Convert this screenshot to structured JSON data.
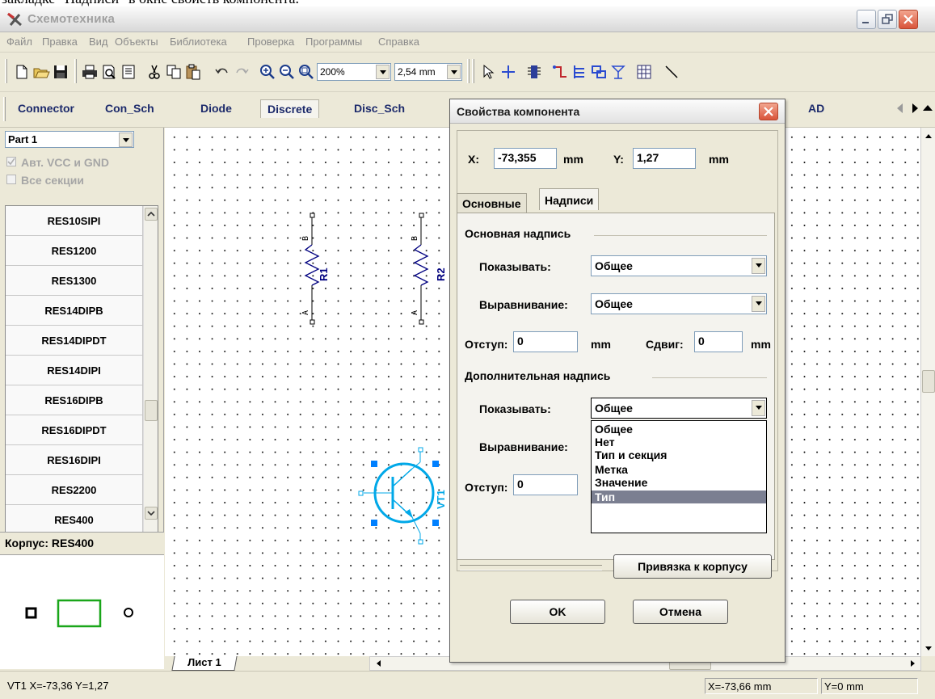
{
  "caption_fragment": "закладке \"Надписи\" в окне свойств компонента.",
  "window": {
    "title": "Схемотехника"
  },
  "menu": [
    "Файл",
    "Правка",
    "Вид",
    "Объекты",
    "Библиотека",
    "Проверка",
    "Программы",
    "Справка"
  ],
  "toolbar": {
    "zoom_value": "200%",
    "grid_value": "2,54 mm"
  },
  "library_tabs": {
    "items": [
      "Connector",
      "Con_Sch",
      "Diode",
      "Discrete",
      "Disc_Sch",
      "AD"
    ],
    "active": "Discrete"
  },
  "left_panel": {
    "part_select": "Part 1",
    "auto_vcc_gnd": "Авт. VCC и GND",
    "all_sections": "Все секции",
    "components": [
      "RES10SIPI",
      "RES1200",
      "RES1300",
      "RES14DIPB",
      "RES14DIPDT",
      "RES14DIPI",
      "RES16DIPB",
      "RES16DIPDT",
      "RES16DIPI",
      "RES2200",
      "RES400"
    ],
    "footprint_label": "Корпус: RES400"
  },
  "schematic": {
    "resistors": [
      {
        "ref": "R1",
        "pin_top": "B",
        "pin_bottom": "A"
      },
      {
        "ref": "R2",
        "pin_top": "B",
        "pin_bottom": "A"
      }
    ],
    "transistor": {
      "ref": "VT1"
    },
    "colors": {
      "component": "#000080",
      "selected": "#00a8e8",
      "handle": "#0080ff"
    }
  },
  "sheet_tab": "Лист 1",
  "status": {
    "left": "VT1  X=-73,36 Y=1,27",
    "x": "X=-73,66 mm",
    "y": "Y=0 mm"
  },
  "dialog": {
    "title": "Свойства компонента",
    "x_label": "X:",
    "x_value": "-73,355",
    "y_label": "Y:",
    "y_value": "1,27",
    "unit": "mm",
    "tabs": [
      "Основные",
      "Надписи"
    ],
    "active_tab": "Надписи",
    "main_label_group": "Основная надпись",
    "show_label": "Показывать:",
    "show_value": "Общее",
    "align_label": "Выравнивание:",
    "align_value": "Общее",
    "offset_label": "Отступ:",
    "offset_value": "0",
    "shift_label": "Сдвиг:",
    "shift_value": "0",
    "extra_label_group": "Дополнительная надпись",
    "extra_show_value": "Общее",
    "extra_align_label": "Выравнивание:",
    "extra_offset_label": "Отступ:",
    "extra_offset_value": "0",
    "dropdown_options": [
      "Общее",
      "Нет",
      "Тип и секция",
      "Метка",
      "Значение",
      "Тип"
    ],
    "dropdown_selected": "Тип",
    "bind_button": "Привязка к корпусу",
    "ok_button": "OK",
    "cancel_button": "Отмена"
  }
}
